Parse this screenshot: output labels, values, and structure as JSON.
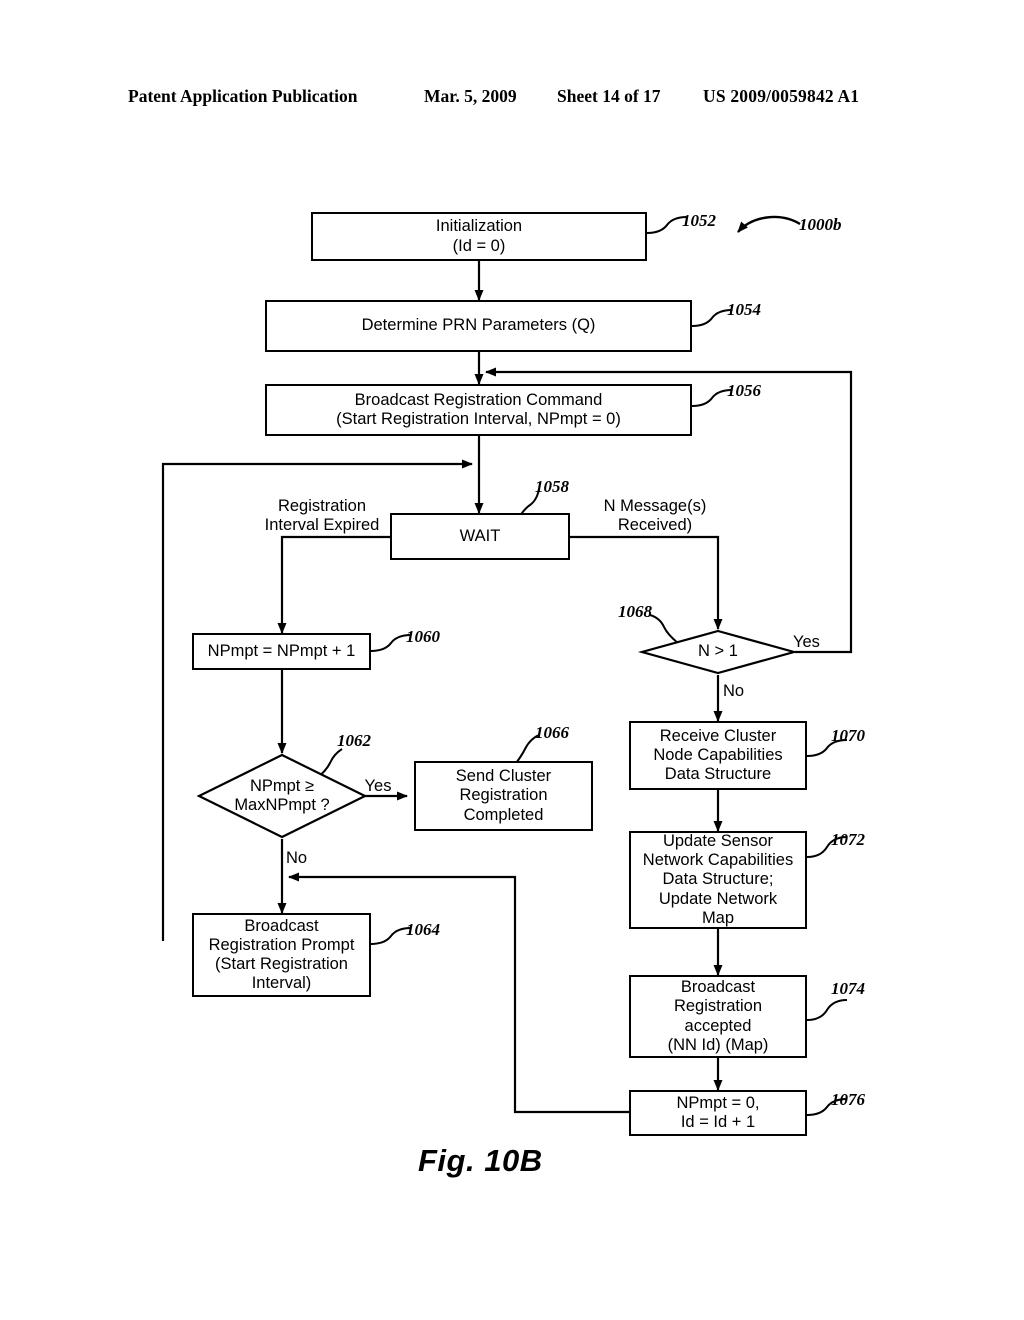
{
  "header": {
    "publication": "Patent Application Publication",
    "date": "Mar. 5, 2009",
    "sheet": "Sheet 14 of 17",
    "number": "US 2009/0059842 A1"
  },
  "figure": {
    "caption": "Fig. 10B",
    "diagram_ref": "1000b",
    "nodes": [
      {
        "ref": "1052",
        "text": "Initialization\n(Id = 0)"
      },
      {
        "ref": "1054",
        "text": "Determine PRN Parameters (Q)"
      },
      {
        "ref": "1056",
        "text": "Broadcast Registration Command\n(Start Registration Interval, NPmpt = 0)"
      },
      {
        "ref": "1058",
        "text": "WAIT"
      },
      {
        "ref": "1060",
        "text": "NPmpt = NPmpt + 1"
      },
      {
        "ref": "1062",
        "text": "NPmpt ≥\nMaxNPmpt ?"
      },
      {
        "ref": "1064",
        "text": "Broadcast\nRegistration Prompt\n(Start Registration\nInterval)"
      },
      {
        "ref": "1066",
        "text": "Send Cluster\nRegistration\nCompleted"
      },
      {
        "ref": "1068",
        "text": "N > 1"
      },
      {
        "ref": "1070",
        "text": "Receive Cluster\nNode Capabilities\nData Structure"
      },
      {
        "ref": "1072",
        "text": "Update Sensor\nNetwork Capabilities\nData Structure;\nUpdate Network\nMap"
      },
      {
        "ref": "1074",
        "text": "Broadcast\nRegistration\naccepted\n(NN Id) (Map)"
      },
      {
        "ref": "1076",
        "text": "NPmpt = 0,\nId = Id + 1"
      }
    ],
    "edge_labels": [
      {
        "name": "wait-left-condition",
        "text": "Registration\nInterval Expired"
      },
      {
        "name": "wait-right-condition",
        "text": "N Message(s)\nReceived)"
      },
      {
        "name": "maxnpmpt-yes",
        "text": "Yes"
      },
      {
        "name": "maxnpmpt-no",
        "text": "No"
      },
      {
        "name": "ngt1-yes",
        "text": "Yes"
      },
      {
        "name": "ngt1-no",
        "text": "No"
      }
    ]
  }
}
